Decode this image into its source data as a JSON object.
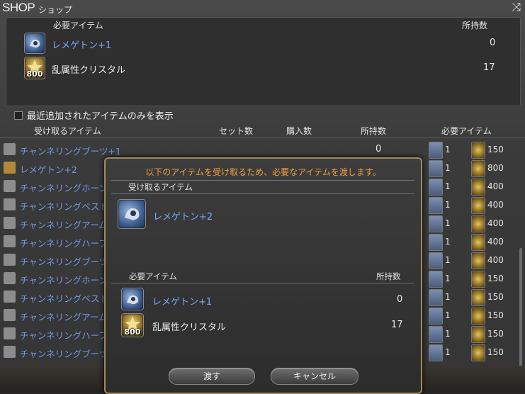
{
  "window": {
    "title_main": "SHOP",
    "title_sub": "ショップ",
    "close_glyph": "⤨"
  },
  "top_panel": {
    "header_item": "必要アイテム",
    "header_owned": "所持数",
    "items": [
      {
        "name": "レメゲトン+1",
        "owned": "0",
        "qty_label": "",
        "icon": "remegeton-icon"
      },
      {
        "name": "乱属性クリスタル",
        "owned": "17",
        "qty_label": "800",
        "icon": "crystal-icon"
      }
    ]
  },
  "filter": {
    "label": "最近追加されたアイテムのみを表示"
  },
  "list_headers": {
    "receive": "受け取るアイテム",
    "sets": "セット数",
    "purchases": "購入数",
    "owned": "所持数",
    "required": "必要アイテム"
  },
  "list_rows": [
    {
      "name": "チャンネリングブーツ+1",
      "owned": "0",
      "req_a": "1",
      "req_b": "150",
      "icon": "boots-icon"
    },
    {
      "name": "レメゲトン+2",
      "owned": "",
      "req_a": "1",
      "req_b": "800",
      "icon": "book-icon"
    },
    {
      "name": "チャンネリングホーン",
      "owned": "",
      "req_a": "1",
      "req_b": "400",
      "icon": "horn-icon"
    },
    {
      "name": "チャンネリングベスト",
      "owned": "",
      "req_a": "1",
      "req_b": "400",
      "icon": "vest-icon"
    },
    {
      "name": "チャンネリングアーム",
      "owned": "",
      "req_a": "1",
      "req_b": "400",
      "icon": "arm-icon"
    },
    {
      "name": "チャンネリングハーフ",
      "owned": "",
      "req_a": "1",
      "req_b": "400",
      "icon": "half-icon"
    },
    {
      "name": "チャンネリングブーツ",
      "owned": "",
      "req_a": "1",
      "req_b": "400",
      "icon": "boots-icon"
    },
    {
      "name": "チャンネリングホーン",
      "owned": "",
      "req_a": "1",
      "req_b": "150",
      "icon": "horn-icon"
    },
    {
      "name": "チャンネリングベスト",
      "owned": "",
      "req_a": "1",
      "req_b": "150",
      "icon": "vest-icon"
    },
    {
      "name": "チャンネリングアーム",
      "owned": "",
      "req_a": "1",
      "req_b": "150",
      "icon": "arm-icon"
    },
    {
      "name": "チャンネリングハーフ",
      "owned": "",
      "req_a": "1",
      "req_b": "150",
      "icon": "half-icon"
    },
    {
      "name": "チャンネリングブーツ",
      "owned": "",
      "req_a": "1",
      "req_b": "150",
      "icon": "boots-icon"
    }
  ],
  "modal": {
    "message": "以下のアイテムを受け取るため、必要なアイテムを渡します。",
    "receive_header": "受け取るアイテム",
    "receive_item": "レメゲトン+2",
    "required_header": "必要アイテム",
    "owned_header": "所持数",
    "required_items": [
      {
        "name": "レメゲトン+1",
        "owned": "0",
        "qty_label": ""
      },
      {
        "name": "乱属性クリスタル",
        "owned": "17",
        "qty_label": "800"
      }
    ],
    "confirm_label": "渡す",
    "cancel_label": "キャンセル"
  },
  "colors": {
    "item_name_blue": "#7aa8ff",
    "modal_message": "#f0a040",
    "modal_border": "#a08a5a"
  }
}
